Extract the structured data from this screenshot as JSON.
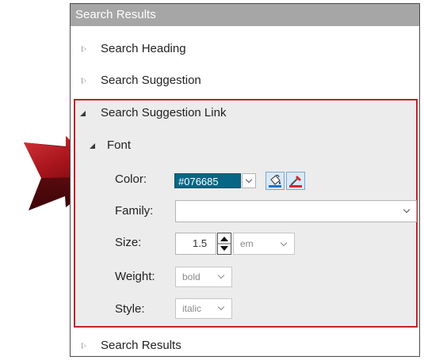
{
  "header": {
    "title": "Search Results"
  },
  "tree": {
    "search_heading": "Search Heading",
    "search_suggestion": "Search Suggestion",
    "search_suggestion_link": "Search Suggestion Link",
    "font_group": "Font",
    "search_results": "Search Results"
  },
  "font": {
    "color_label": "Color:",
    "color_value": "#076685",
    "family_label": "Family:",
    "family_value": "",
    "size_label": "Size:",
    "size_value": "1.5",
    "size_unit": "em",
    "weight_label": "Weight:",
    "weight_value": "bold",
    "style_label": "Style:",
    "style_value": "italic"
  },
  "icons": {
    "arrow": "red-pointer-arrow-icon",
    "fill_color": "paint-bucket-icon",
    "pick_color": "eyedropper-icon",
    "spinner_up": "caret-up-icon",
    "spinner_down": "caret-down-icon"
  },
  "colors": {
    "header_bg": "#a6a6a6",
    "highlight_border": "#c0242b",
    "selection_bg": "#ececec",
    "swatch": "#076685"
  }
}
